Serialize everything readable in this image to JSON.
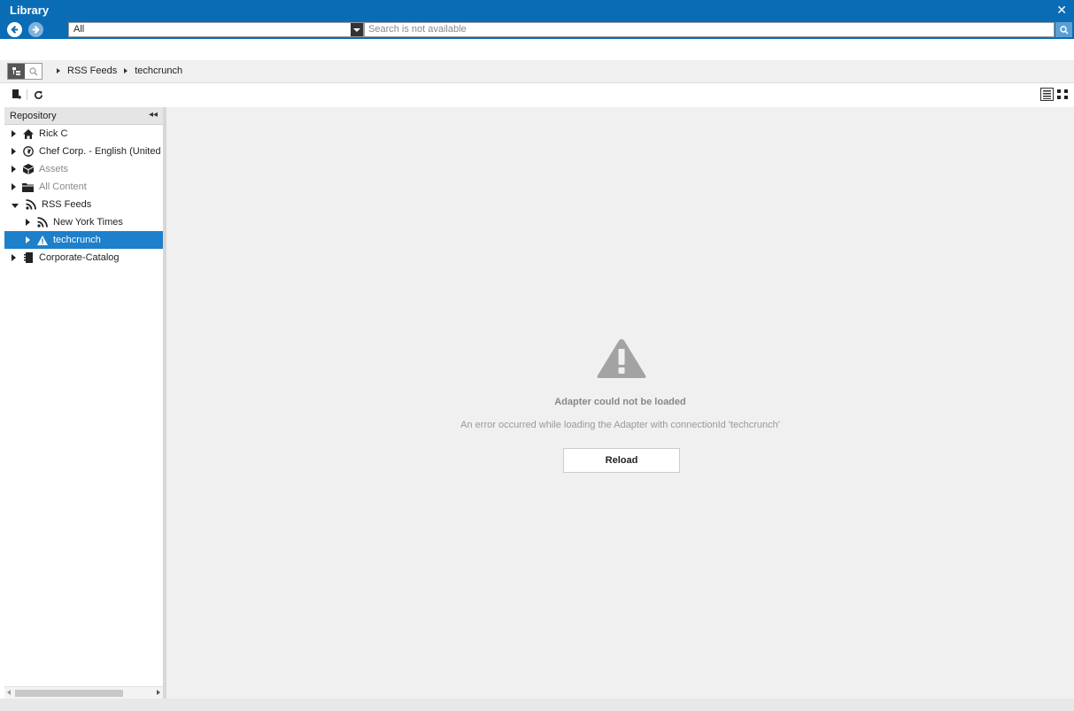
{
  "window": {
    "title": "Library",
    "close_icon": "close-icon"
  },
  "search": {
    "scope_value": "All",
    "placeholder": "Search is not available"
  },
  "breadcrumb": [
    "RSS Feeds",
    "techcrunch"
  ],
  "sidebar": {
    "title": "Repository",
    "items": [
      {
        "label": "Rick C",
        "icon": "home-icon",
        "expanded": false,
        "dim": false,
        "level": 0
      },
      {
        "label": "Chef Corp. - English (United",
        "icon": "globe-icon",
        "expanded": false,
        "dim": false,
        "level": 0
      },
      {
        "label": "Assets",
        "icon": "box-icon",
        "expanded": false,
        "dim": true,
        "level": 0
      },
      {
        "label": "All Content",
        "icon": "folder-icon",
        "expanded": false,
        "dim": true,
        "level": 0
      },
      {
        "label": "RSS Feeds",
        "icon": "rss-icon",
        "expanded": true,
        "dim": false,
        "level": 0
      },
      {
        "label": "New York Times",
        "icon": "rss-icon",
        "expanded": false,
        "dim": false,
        "level": 1
      },
      {
        "label": "techcrunch",
        "icon": "warning-icon",
        "expanded": false,
        "dim": false,
        "level": 1,
        "selected": true
      },
      {
        "label": "Corporate-Catalog",
        "icon": "catalog-icon",
        "expanded": false,
        "dim": false,
        "level": 0
      }
    ]
  },
  "error": {
    "title": "Adapter could not be loaded",
    "message": "An error occurred while loading the Adapter with connectionId 'techcrunch'",
    "button": "Reload"
  },
  "colors": {
    "header": "#0a6cb5",
    "selected": "#1e7fca",
    "main_bg": "#f0f0f0"
  }
}
